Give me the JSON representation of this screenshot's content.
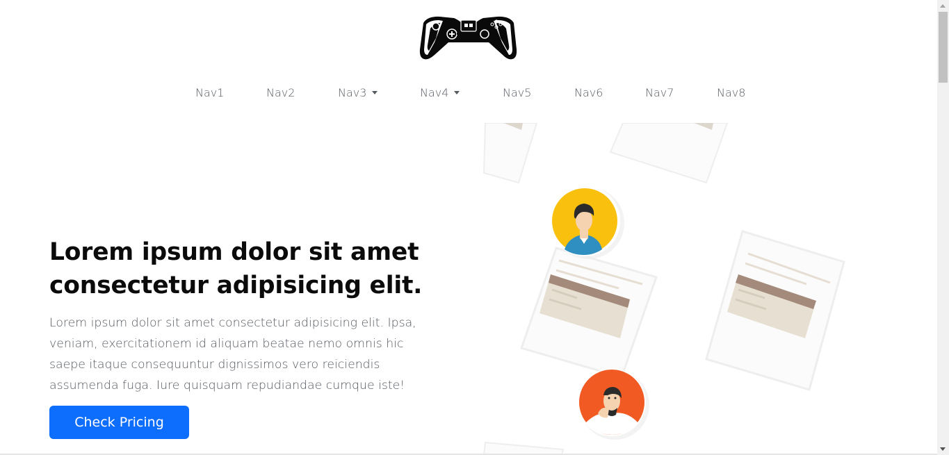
{
  "brand": {
    "logo_icon": "gamepad-logo-icon"
  },
  "nav": {
    "items": [
      {
        "label": "Nav1",
        "dropdown": false
      },
      {
        "label": "Nav2",
        "dropdown": false
      },
      {
        "label": "Nav3",
        "dropdown": true
      },
      {
        "label": "Nav4",
        "dropdown": true
      },
      {
        "label": "Nav5",
        "dropdown": false
      },
      {
        "label": "Nav6",
        "dropdown": false
      },
      {
        "label": "Nav7",
        "dropdown": false
      },
      {
        "label": "Nav8",
        "dropdown": false
      }
    ]
  },
  "hero": {
    "title": "Lorem ipsum dolor sit amet consectetur adipisicing elit.",
    "text": "Lorem ipsum dolor sit amet consectetur adipisicing elit. Ipsa, veniam, exercitationem id aliquam beatae nemo omnis hic saepe itaque consequuntur dignissimos vero reiciendis assumenda fuga. Iure quisquam repudiandae cumque iste!",
    "cta_label": "Check Pricing"
  },
  "colors": {
    "primary": "#0d6efd",
    "avatar_yellow": "#f9c10e",
    "avatar_orange": "#f15a22",
    "card_accent": "#a48a7b"
  }
}
